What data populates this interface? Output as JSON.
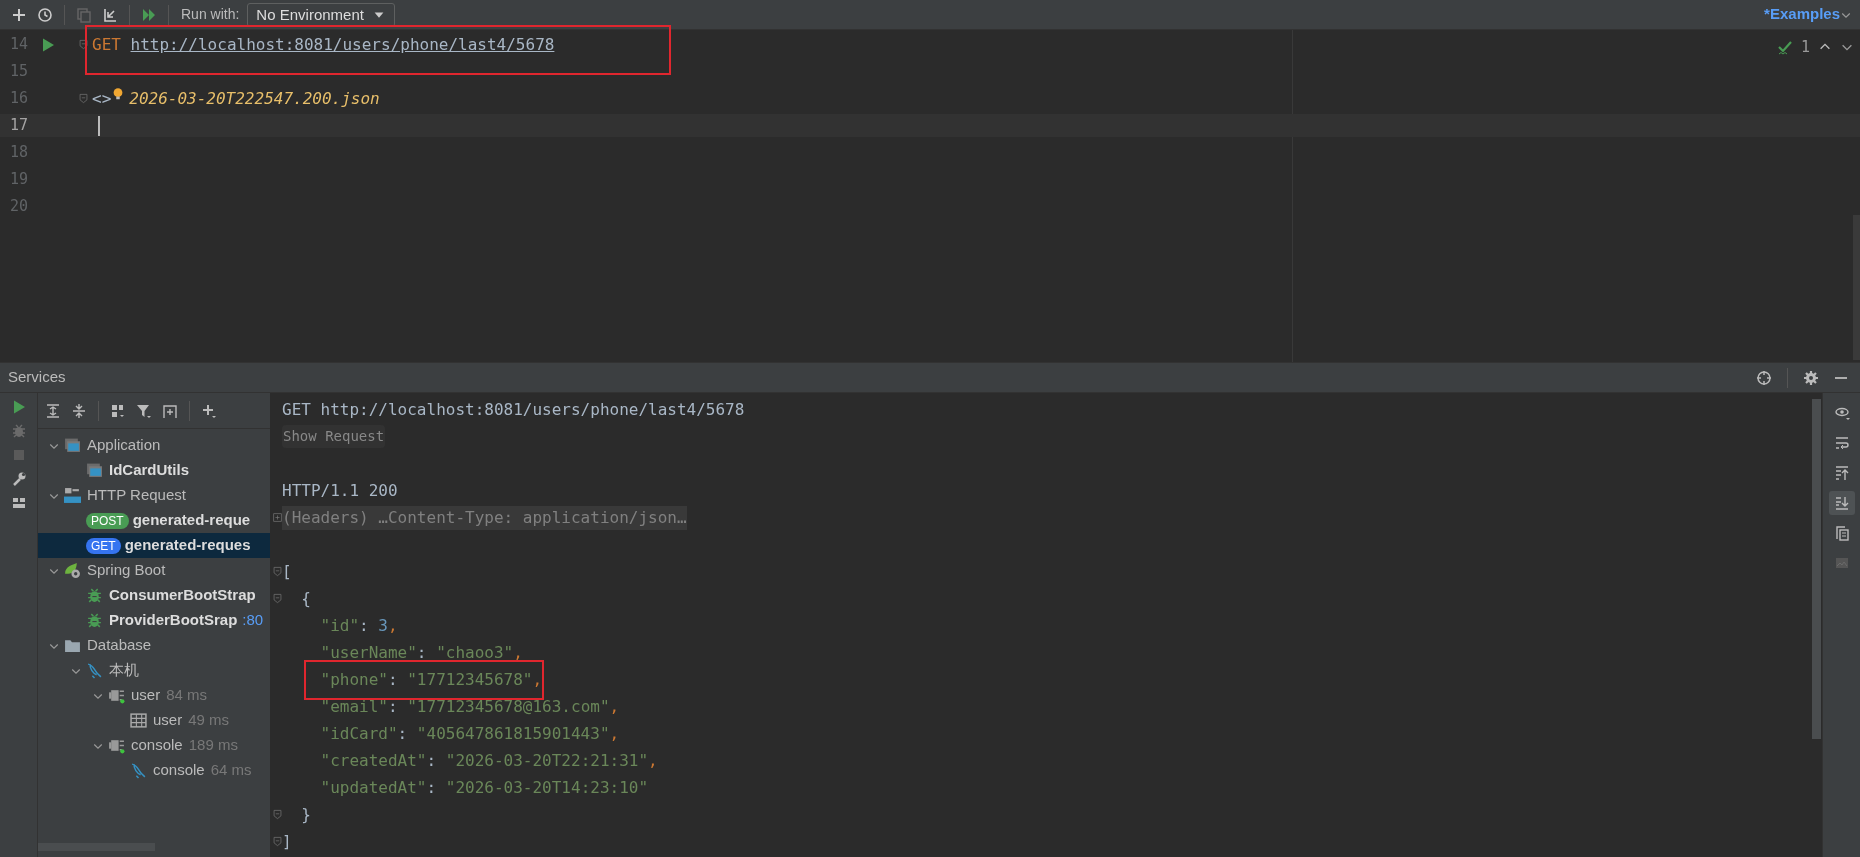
{
  "toolbar": {
    "run_with_label": "Run with:",
    "environment": "No Environment",
    "file_tab": "*Examples"
  },
  "editor": {
    "inspection_count": "1",
    "lines": [
      {
        "number": "14",
        "kind": "request",
        "method": "GET",
        "url": "http://localhost:8081/users/phone/last4/5678",
        "current": false,
        "highlighted": true
      },
      {
        "number": "15",
        "kind": "blank",
        "current": false
      },
      {
        "number": "16",
        "kind": "response_ref",
        "prefix": "<>",
        "file": "2026-03-20T222547.200.json",
        "current": false
      },
      {
        "number": "17",
        "kind": "blank",
        "current": true
      },
      {
        "number": "18",
        "kind": "blank",
        "current": false
      },
      {
        "number": "19",
        "kind": "blank",
        "current": false
      },
      {
        "number": "20",
        "kind": "blank",
        "current": false
      }
    ]
  },
  "services": {
    "title": "Services",
    "tree": [
      {
        "label": "Application",
        "kind": "app",
        "expanded": true,
        "bold": false,
        "selected": false,
        "children": [
          {
            "label": "IdCardUtils",
            "kind": "app",
            "bold": true,
            "selected": false
          }
        ]
      },
      {
        "label": "HTTP Request",
        "kind": "api",
        "expanded": true,
        "bold": false,
        "selected": false,
        "children": [
          {
            "label": "generated-reque",
            "kind": "request",
            "badge": {
              "label": "POST",
              "color": "#499c54"
            },
            "bold": true,
            "selected": false
          },
          {
            "label": "generated-reques",
            "kind": "request",
            "badge": {
              "label": "GET",
              "color": "#3574f0"
            },
            "bold": true,
            "selected": true
          }
        ]
      },
      {
        "label": "Spring Boot",
        "kind": "spring",
        "expanded": true,
        "bold": false,
        "selected": false,
        "children": [
          {
            "label": "ConsumerBootStrap",
            "kind": "service",
            "bold": true,
            "selected": false
          },
          {
            "label": "ProviderBootSrap",
            "kind": "service",
            "bold": true,
            "selected": false,
            "suffix": ":80"
          }
        ]
      },
      {
        "label": "Database",
        "kind": "folder",
        "expanded": true,
        "bold": false,
        "selected": false,
        "children": [
          {
            "label": "本机",
            "kind": "mysql",
            "expanded": true,
            "bold": false,
            "selected": false,
            "children": [
              {
                "label": "user",
                "kind": "datasource",
                "expanded": true,
                "bold": false,
                "selected": false,
                "suffix": "84 ms",
                "children": [
                  {
                    "label": "user",
                    "kind": "table",
                    "bold": false,
                    "selected": false,
                    "suffix": "49 ms"
                  }
                ]
              },
              {
                "label": "console",
                "kind": "datasource",
                "expanded": true,
                "bold": false,
                "selected": false,
                "suffix": "189 ms",
                "children": [
                  {
                    "label": "console",
                    "kind": "mysql",
                    "bold": false,
                    "selected": false,
                    "suffix": "64 ms"
                  }
                ]
              }
            ]
          }
        ]
      }
    ],
    "response": {
      "request_line": "GET http://localhost:8081/users/phone/last4/5678",
      "show_request": "Show Request",
      "status": "HTTP/1.1 200",
      "headers": {
        "summary": "(Headers) …Content-Type: application/json…",
        "expanded": false
      },
      "body": {
        "open": "[",
        "items": [
          {
            "open": "{",
            "fields": [
              {
                "key": "\"id\"",
                "sep": ": ",
                "value": "3",
                "kind": "number",
                "trail": ","
              },
              {
                "key": "\"userName\"",
                "sep": ": ",
                "value": "\"chaoo3\"",
                "kind": "string",
                "trail": ","
              },
              {
                "key": "\"phone\"",
                "sep": ": ",
                "value": "\"17712345678\"",
                "kind": "string",
                "trail": ",",
                "highlighted": true
              },
              {
                "key": "\"email\"",
                "sep": ": ",
                "value": "\"17712345678@163.com\"",
                "kind": "string",
                "trail": ","
              },
              {
                "key": "\"idCard\"",
                "sep": ": ",
                "value": "\"405647861815901443\"",
                "kind": "string",
                "trail": ","
              },
              {
                "key": "\"createdAt\"",
                "sep": ": ",
                "value": "\"2026-03-20T22:21:31\"",
                "kind": "string",
                "trail": ","
              },
              {
                "key": "\"updatedAt\"",
                "sep": ": ",
                "value": "\"2026-03-20T14:23:10\"",
                "kind": "string"
              }
            ],
            "close": "}"
          }
        ],
        "close": "]"
      }
    }
  }
}
